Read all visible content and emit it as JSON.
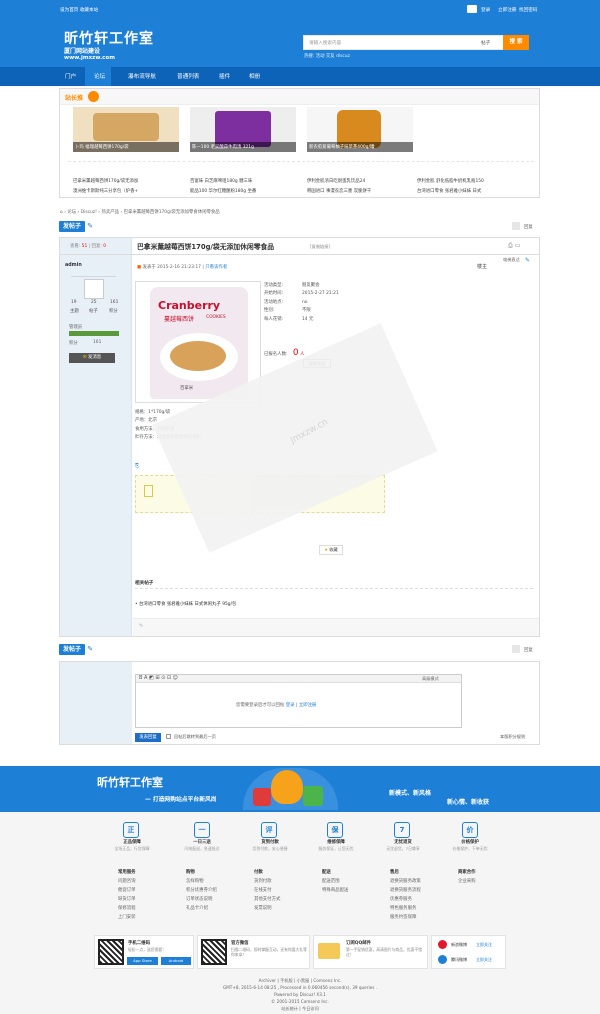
{
  "topbar": {
    "links": "设为首页  收藏本站",
    "login": "登录",
    "register": "立即注册",
    "forgot": "找回密码"
  },
  "header": {
    "title": "昕竹轩工作室",
    "subtitle": "厦门网站建设",
    "url": "www.jmxzw.com",
    "search_placeholder": "请输入搜索内容",
    "search_type": "帖子",
    "search_button": "搜 索",
    "hot_label": "热搜:",
    "hot": [
      "活动",
      "交友",
      "discuz"
    ]
  },
  "nav": [
    "门户",
    "论坛",
    "瀑布流导航",
    "普通列表",
    "插件",
    "相册"
  ],
  "recommend": {
    "title": "站长推",
    "tiles": [
      "卜玛 福瑞越莓西饼170g/袋",
      "陈—100 老吴酸蒜牛肉汤 321g",
      "新农愈爱葡萄柚子味苹茶400g/罐"
    ],
    "links": [
      [
        "巴拿米薰越莓西饼170g/袋无添加",
        "百富味 白芝麻啤咀180g 糖三味",
        "伊利金肌浓白吃厨蛋乳饮品24",
        "伊利金肌 舒化低脂牛奶机乳瓶150"
      ],
      [
        "澳洲维卡斯斯纯三分享包（炉香+",
        "能品100 华尔红糖酪粉180g 坐番",
        "韩国进口 事漫农恋三墨 炭脆饼干",
        "台湾进口零食 张君雅小妹妹 日式"
      ]
    ]
  },
  "breadcrumb": [
    "论坛",
    "Discuz!",
    "热卖产品",
    "巴拿米薰越莓西饼170g/袋无添加零食休闲零食品"
  ],
  "post_button": "发帖子",
  "reply": "回复",
  "stats": {
    "views": "查看:",
    "views_n": "51",
    "replies": "回复:",
    "replies_n": "0"
  },
  "thread_title": "巴拿米薰越莓西饼170g/袋无添加休闲零食品",
  "copy_link": "[复制链接]",
  "author": {
    "name": "admin",
    "counts": [
      "19",
      "25",
      "161"
    ],
    "count_labels": [
      "主题",
      "帖子",
      "积分"
    ],
    "group": "管理员",
    "points_label": "积分",
    "points": "161",
    "msg": "发消息"
  },
  "post": {
    "meta": "发表于 2015-2-16 21:23:17",
    "author_only": "只看该作者",
    "view_mode": "电梯直达",
    "floor": "楼主"
  },
  "product": {
    "label": "Cranberry",
    "zh": "蔓越莓西饼",
    "en": "COOKIES",
    "brand": "百拿米"
  },
  "activity": {
    "type_label": "活动类型:",
    "type": "朋友聚会",
    "start_label": "开始时间:",
    "start": "2015-2-27 21:21",
    "place_label": "活动地点:",
    "place": "no",
    "gender_label": "性别:",
    "gender": "不限",
    "cost_label": "每人花销:",
    "cost": "14 元",
    "joined_label": "已报名人数:",
    "joined": "0",
    "unit": "人",
    "join_button": "我要参加"
  },
  "desc": [
    "规格：1*170g/袋",
    "产地：北京",
    "食用方法：开袋即食",
    "贮存方法：常温保存避免阳光直射"
  ],
  "watermark": "jmxzw.cn",
  "fav": "收藏",
  "related": "相关帖子",
  "related_item": "• 台湾进口零食 张君雅小妹妹 日式休闲丸子 95g/包",
  "reply_ph": "您需要登录后才可以回帖",
  "login": "登录",
  "or": "|",
  "register": "立即注册",
  "reply_btn": "发表回复",
  "reply_opt": "回帖后跳转到最后一页",
  "adv": "高级模式",
  "reply_tail": "本版积分规则",
  "banner": {
    "title": "昕竹轩工作室",
    "slogan": "— 打造网购站点平台新风尚",
    "r1": "新模式、新风格",
    "r2": "新心情、新收获"
  },
  "features": [
    [
      "正",
      "正品保障",
      "全场正品，行货保障"
    ],
    [
      "一",
      "一日三送",
      "闪电配送，急速抵达"
    ],
    [
      "评",
      "货到付款",
      "货到付款，安心便捷"
    ],
    [
      "保",
      "维修保障",
      "服务保证，让您无忧"
    ],
    [
      "7",
      "无忧退货",
      "无忧退货，7日尊享"
    ],
    [
      "价",
      "价格保护",
      "价格保护，下单无忧"
    ]
  ],
  "cols": [
    {
      "h": "常用服务",
      "l": [
        "问题咨询",
        "催促订单",
        "缺货订单",
        "保修流程",
        "上门安装"
      ]
    },
    {
      "h": "购物",
      "l": [
        "怎样购物",
        "积分优惠券介绍",
        "订单状态说明",
        "礼品卡介绍"
      ]
    },
    {
      "h": "付款",
      "l": [
        "货到付款",
        "在线支付",
        "其他支付方式",
        "发票说明"
      ]
    },
    {
      "h": "配送",
      "l": [
        "配送范围",
        "特殊商品配送"
      ]
    },
    {
      "h": "售后",
      "l": [
        "退换货服务政策",
        "退换货服务流程",
        "优惠券服务",
        "特色服务服务",
        "服务约签保障"
      ]
    },
    {
      "h": "商家合作",
      "l": [
        "企业采购"
      ]
    }
  ],
  "apps": {
    "phone": "手机二维码",
    "phone_sub": "轻松一点，选您需要！",
    "appstore": "App Store",
    "android": "Android",
    "wechat": "官方微信",
    "wechat_sub": "扫描二维码，即时掌握互动，还有惊喜大礼等你来拿！",
    "mail": "订阅QQ邮件",
    "mail_sub": "第一手促销优惠，高清图片与商品，优惠不错过！",
    "weibo": "新浪微博",
    "weibo_btn": "立即关注",
    "tweibo": "腾讯微博",
    "tweibo_btn": "立即关注"
  },
  "footer": [
    "Archiver | 手机版 | 小黑屋 | Comsenz Inc.",
    "GMT+8, 2015-6-14 08:25 , Processed in 0.060456 second(s), 39 queries .",
    "Powered by Discuz! X3.1",
    "© 2001-2015 Comsenz Inc.",
    "站长统计  |  今日访问"
  ],
  "colors": {
    "brand": "#1e7fd6",
    "nav": "#0d63b7",
    "orange": "#ff8a00"
  }
}
